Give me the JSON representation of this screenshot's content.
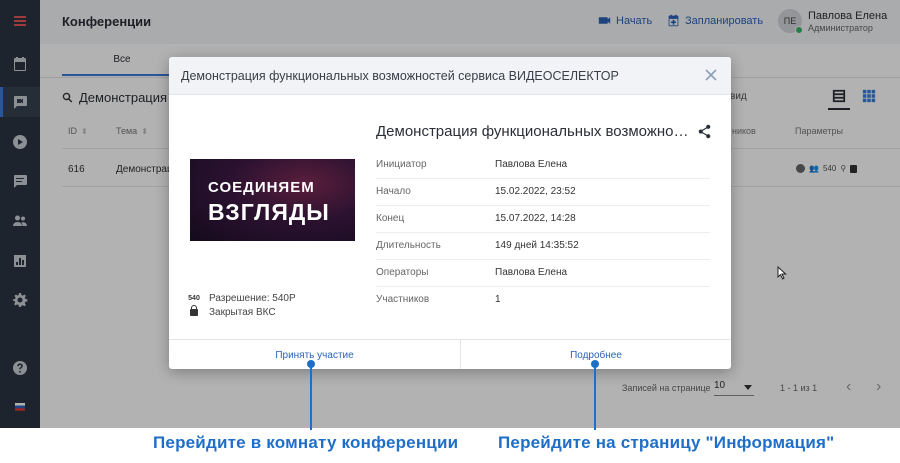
{
  "header": {
    "page_title": "Конференции",
    "start_label": "Начать",
    "schedule_label": "Запланировать",
    "user_initials": "ПЕ",
    "user_name": "Павлова Елена",
    "user_role": "Администратор"
  },
  "tabs": {
    "all_label": "Все"
  },
  "search": {
    "value": "Демонстрация"
  },
  "view": {
    "label": "вид"
  },
  "table": {
    "columns": {
      "id": "ID",
      "topic": "Тема",
      "participants": "ников",
      "params": "Параметры"
    },
    "rows": [
      {
        "id": "616",
        "topic": "Демонстрац",
        "resolution_badge": "540"
      }
    ]
  },
  "footer": {
    "per_page_label": "Записей на странице",
    "per_page_value": "10",
    "range_text": "1 - 1 из 1"
  },
  "modal": {
    "header_title": "Демонстрация функциональных возможностей сервиса ВИДЕОСЕЛЕКТОР",
    "conference_title": "Демонстрация функциональных возможностей сервиса ВИДЕОСЕЛЕКТОР",
    "banner": {
      "line1": "СОЕДИНЯЕМ",
      "line2": "ВЗГЛЯДЫ"
    },
    "meta": {
      "resolution_badge": "540",
      "resolution": "Разрешение: 540P",
      "access": "Закрытая ВКС"
    },
    "details": [
      {
        "key": "Инициатор",
        "value": "Павлова Елена"
      },
      {
        "key": "Начало",
        "value": "15.02.2022, 23:52"
      },
      {
        "key": "Конец",
        "value": "15.07.2022, 14:28"
      },
      {
        "key": "Длительность",
        "value": "149 дней 14:35:52"
      },
      {
        "key": "Операторы",
        "value": "Павлова Елена"
      },
      {
        "key": "Участников",
        "value": "1"
      }
    ],
    "join_label": "Принять участие",
    "more_label": "Подробнее"
  },
  "callouts": {
    "join": "Перейдите в комнату конференции",
    "info": "Перейдите на страницу \"Информация\""
  },
  "colors": {
    "accent": "#2b62b8",
    "callout": "#1f6fc8",
    "sidebar": "#2a3442",
    "status_online": "#3bb36b",
    "menu_red": "#e25757"
  }
}
